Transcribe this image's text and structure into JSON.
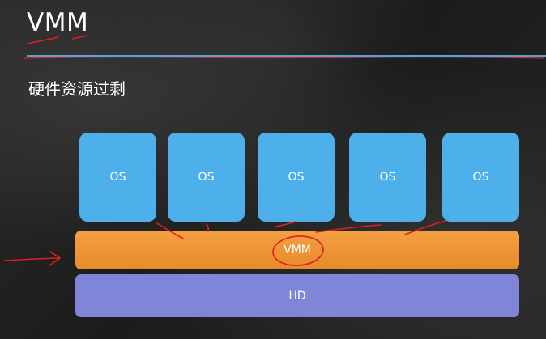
{
  "slide": {
    "title": "VMM",
    "subtitle": "硬件资源过剩"
  },
  "diagram": {
    "os_boxes": [
      "OS",
      "OS",
      "OS",
      "OS",
      "OS"
    ],
    "vmm_label": "VMM",
    "hd_label": "HD"
  },
  "colors": {
    "background": "#232323",
    "title_rule": "#4aa8de",
    "os_box": "#4db0ea",
    "vmm_layer": "#e88a2a",
    "hd_layer": "#7f86d8",
    "annotation": "#e02020"
  }
}
